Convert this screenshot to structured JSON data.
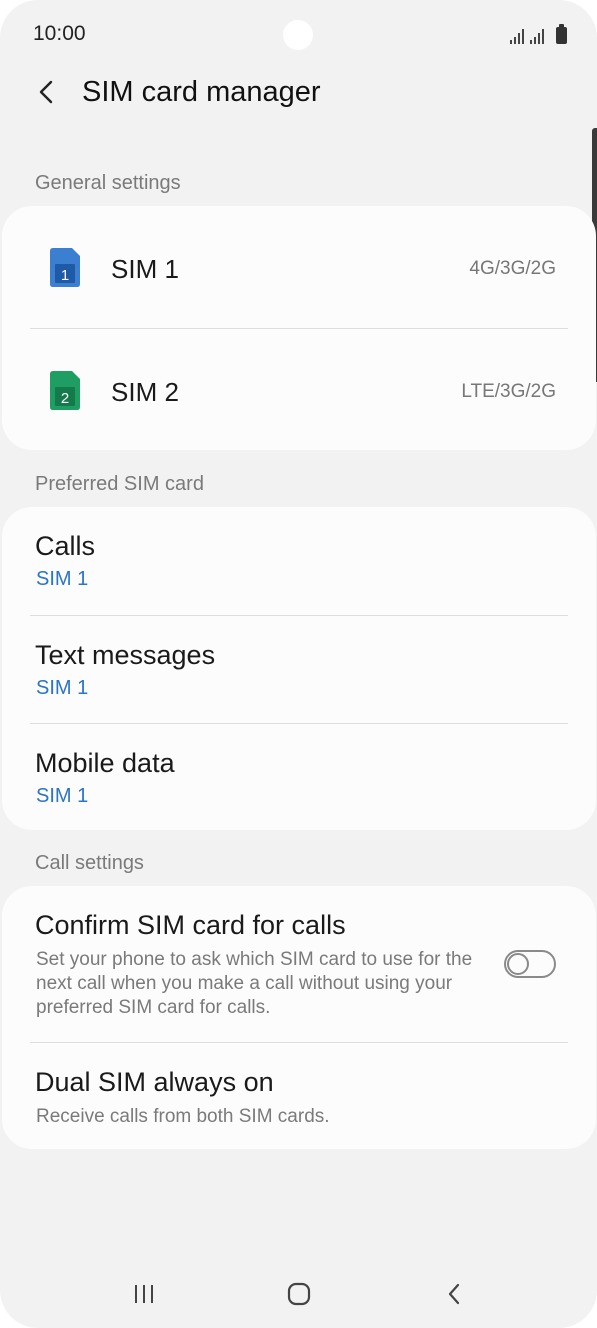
{
  "status_bar": {
    "time": "10:00"
  },
  "app_bar": {
    "back_icon": "chevron-left-icon",
    "title": "SIM card manager"
  },
  "general_settings": {
    "label": "General settings",
    "sims": [
      {
        "name": "SIM 1",
        "network": "4G/3G/2G",
        "badge": "1",
        "color": "#3b7fd1",
        "icon": "sim-card-icon"
      },
      {
        "name": "SIM 2",
        "network": "LTE/3G/2G",
        "badge": "2",
        "color": "#1f9e64",
        "icon": "sim-card-icon"
      }
    ]
  },
  "preferred_sim": {
    "label": "Preferred SIM card",
    "items": [
      {
        "title": "Calls",
        "value": "SIM 1"
      },
      {
        "title": "Text messages",
        "value": "SIM 1"
      },
      {
        "title": "Mobile data",
        "value": "SIM 1"
      }
    ]
  },
  "call_settings": {
    "label": "Call settings",
    "confirm": {
      "title": "Confirm SIM card for calls",
      "description": "Set your phone to ask which SIM card to use for the next call when you make a call without using your preferred SIM card for calls.",
      "enabled": false
    },
    "dual_sim": {
      "title": "Dual SIM always on",
      "description": "Receive calls from both SIM cards."
    }
  },
  "nav_bar": {
    "recents_icon": "recents-icon",
    "home_icon": "home-icon",
    "back_icon": "back-icon"
  },
  "colors": {
    "accent": "#2a74c9",
    "background": "#f2f2f2",
    "card": "#fcfcfc"
  }
}
